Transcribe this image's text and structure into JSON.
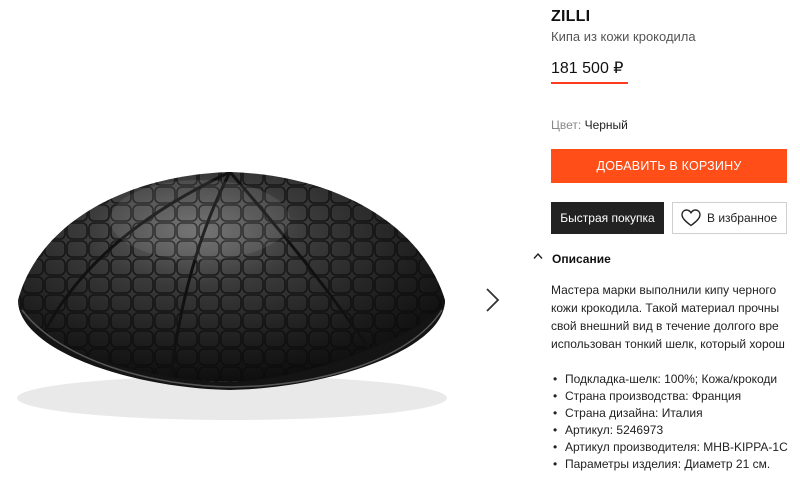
{
  "product": {
    "brand": "ZILLI",
    "name": "Кипа из кожи крокодила",
    "price": "181 500 ₽",
    "color_label": "Цвет:",
    "color_value": "Черный"
  },
  "actions": {
    "add_to_cart": "ДОБАВИТЬ В КОРЗИНУ",
    "quick_buy": "Быстрая покупка",
    "favorites": "В избранное"
  },
  "description": {
    "title": "Описание",
    "lines": [
      "Мастера марки выполнили кипу черного",
      "кожи крокодила. Такой  материал прочны",
      "свой внешний вид в течение долгого вре",
      "использован тонкий шелк, который хорош"
    ],
    "specs": [
      "Подкладка-шелк: 100%; Кожа/крокоди",
      "Страна производства: Франция",
      "Страна дизайна: Италия",
      "Артикул: 5246973",
      "Артикул производителя: MHB-KIPPA-1С",
      "Параметры изделия: Диаметр 21 см."
    ]
  },
  "icons": {
    "gallery_next": "chevron-right-icon",
    "description_toggle": "chevron-up-icon",
    "favorite": "heart-icon"
  },
  "colors": {
    "accent": "#ff4e17",
    "price_underline": "#ff3b1f",
    "quick_buy_bg": "#222222"
  }
}
